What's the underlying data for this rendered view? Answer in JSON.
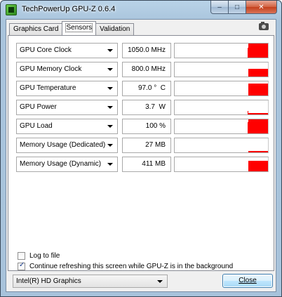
{
  "window": {
    "title": "TechPowerUp GPU-Z 0.6.4",
    "app_icon": "gpu-z-icon",
    "caption_buttons": {
      "minimize": "–",
      "maximize": "□",
      "close": "✕"
    }
  },
  "tabs": [
    {
      "label": "Graphics Card",
      "active": false
    },
    {
      "label": "Sensors",
      "active": true
    },
    {
      "label": "Validation",
      "active": false
    }
  ],
  "screenshot_icon": "camera-icon",
  "sensors": [
    {
      "name": "GPU Core Clock",
      "value": "1050.0 MHz",
      "graph_level": 1.0
    },
    {
      "name": "GPU Memory Clock",
      "value": "800.0 MHz",
      "graph_level": 0.55
    },
    {
      "name": "GPU Temperature",
      "value": "97.0 °  C",
      "graph_level": 0.85
    },
    {
      "name": "GPU Power",
      "value": "3.7  W",
      "graph_level": 0.1
    },
    {
      "name": "GPU Load",
      "value": "100 %",
      "graph_level": 1.0
    },
    {
      "name": "Memory Usage (Dedicated)",
      "value": "27 MB",
      "graph_level": 0.08
    },
    {
      "name": "Memory Usage (Dynamic)",
      "value": "411 MB",
      "graph_level": 0.75
    }
  ],
  "options": {
    "log_to_file": {
      "label": "Log to file",
      "checked": false
    },
    "continue_refreshing": {
      "label": "Continue refreshing this screen while GPU-Z is in the background",
      "checked": true
    }
  },
  "gpu_select": {
    "value": "Intel(R) HD Graphics"
  },
  "close_button": {
    "label": "Close"
  },
  "colors": {
    "graph": "#ff0000",
    "title_bar": "#a9c4dc",
    "button_border": "#3c7fb1"
  }
}
